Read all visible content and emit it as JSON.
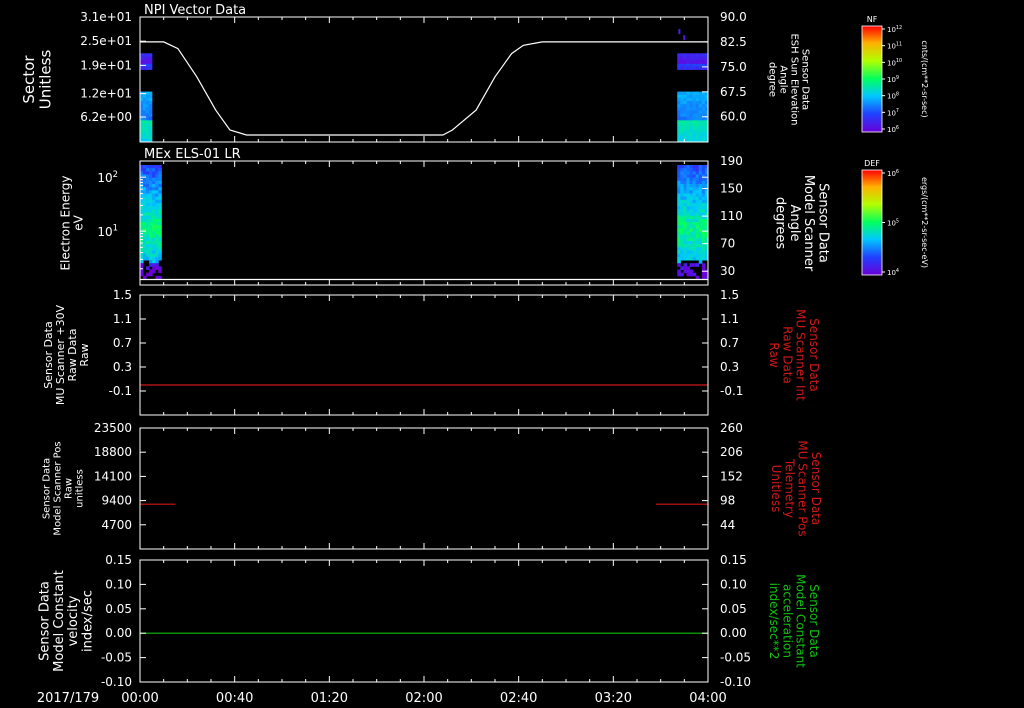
{
  "colors": {
    "background": "#000000",
    "foreground": "#ffffff",
    "red": "#d01818",
    "green": "#10c010"
  },
  "time_axis": {
    "date_label": "2017/179",
    "ticks": [
      "00:00",
      "00:40",
      "01:20",
      "02:00",
      "02:40",
      "03:20",
      "04:00"
    ],
    "range_minutes": [
      0,
      240
    ]
  },
  "chart_data": [
    {
      "type": "heatmap",
      "title": "NPI Vector Data",
      "ylabel": [
        "Sector",
        "Unitless"
      ],
      "y_ticks": [
        "3.1e+01",
        "2.5e+01",
        "1.9e+01",
        "1.2e+01",
        "6.2e+00"
      ],
      "y_tick_values": [
        31,
        25,
        19,
        12,
        6.2
      ],
      "ylim": [
        0,
        31
      ],
      "right_axis": {
        "label": [
          "Sensor Data",
          "ESH Sun Elevation",
          "Angle",
          "degree"
        ],
        "ticks": [
          "90.0",
          "82.5",
          "75.0",
          "67.5",
          "60.0"
        ],
        "tick_values": [
          90,
          82.5,
          75,
          67.5,
          60
        ],
        "ylim": [
          52.4,
          90
        ]
      },
      "color_bar": {
        "label": "NF",
        "units": "cnts/(cm**2-sr-sec)",
        "ticks": [
          "10^12",
          "10^11",
          "10^10",
          "10^9",
          "10^8",
          "10^7",
          "10^6"
        ]
      },
      "coverage_minutes": [
        [
          0,
          5
        ],
        [
          227,
          240
        ]
      ],
      "line_series": {
        "name": "ESH Sun Elevation",
        "color": "#ffffff",
        "x": [
          0,
          10,
          16,
          24,
          32,
          38,
          45,
          60,
          90,
          120,
          128,
          132,
          142,
          150,
          157,
          162,
          170,
          190,
          240
        ],
        "y": [
          82.5,
          82.5,
          80.5,
          72,
          62,
          56,
          54.5,
          54.5,
          54.5,
          54.5,
          54.5,
          56,
          62,
          72,
          79,
          81.5,
          82.5,
          82.5,
          82.5
        ]
      }
    },
    {
      "type": "heatmap",
      "title": "MEx ELS-01 LR",
      "ylabel": [
        "Electron Energy",
        "eV"
      ],
      "y_ticks": [
        "10^2",
        "10^1"
      ],
      "log_scale": true,
      "ylim": [
        1,
        200
      ],
      "right_axis": {
        "label": [
          "Sensor Data",
          "Model Scanner",
          "Angle",
          "degrees"
        ],
        "ticks": [
          "190",
          "150",
          "110",
          "70",
          "30"
        ],
        "tick_values": [
          190,
          150,
          110,
          70,
          30
        ],
        "ylim": [
          10,
          190
        ]
      },
      "color_bar": {
        "label": "DEF",
        "units": "ergs/(cm**2-sr-sec-eV)",
        "ticks": [
          "10^6",
          "10^5",
          "10^4"
        ]
      },
      "coverage_minutes": [
        [
          0,
          9
        ],
        [
          227,
          240
        ]
      ],
      "line_series": {
        "name": "Model Scanner Angle",
        "color": "#ffffff",
        "x": [
          0,
          240
        ],
        "y": [
          18,
          18
        ]
      }
    },
    {
      "type": "line",
      "ylabel": [
        "Sensor Data",
        "MU Scanner +30V",
        "Raw Data",
        "Raw"
      ],
      "y_ticks": [
        "1.5",
        "1.1",
        "0.7",
        "0.3",
        "-0.1"
      ],
      "ylim": [
        -0.5,
        1.5
      ],
      "right_axis": {
        "label": [
          "Sensor Data",
          "MU Scanner Int",
          "Raw Data",
          "Raw"
        ],
        "label_color": "#d01818",
        "ticks": [
          "1.5",
          "1.1",
          "0.7",
          "0.3",
          "-0.1"
        ],
        "ylim": [
          -0.5,
          1.5
        ]
      },
      "series": [
        {
          "color": "#d01818",
          "x": [
            0,
            240
          ],
          "y": [
            0.0,
            0.0
          ]
        }
      ]
    },
    {
      "type": "line",
      "ylabel": [
        "Sensor Data",
        "Model Scanner Pos",
        "Raw",
        "unitless"
      ],
      "y_ticks": [
        "23500",
        "18800",
        "14100",
        "9400",
        "4700"
      ],
      "ylim": [
        0,
        23500
      ],
      "right_axis": {
        "label": [
          "Sensor Data",
          "MU Scanner Pos",
          "Telemetry",
          "Unitless"
        ],
        "label_color": "#d01818",
        "ticks": [
          "260",
          "206",
          "152",
          "98",
          "44"
        ],
        "tick_values": [
          260,
          206,
          152,
          98,
          44
        ],
        "ylim": [
          -10,
          260
        ]
      },
      "series": [
        {
          "color": "#d01818",
          "x": [
            0,
            15
          ],
          "y": [
            90,
            90
          ]
        },
        {
          "color": "#d01818",
          "x": [
            218,
            240
          ],
          "y": [
            90,
            90
          ]
        }
      ]
    },
    {
      "type": "line",
      "ylabel": [
        "Sensor Data",
        "Model Constant",
        "velocity",
        "index/sec"
      ],
      "y_ticks": [
        "0.15",
        "0.10",
        "0.05",
        "0.00",
        "-0.05",
        "-0.10"
      ],
      "ylim": [
        -0.1,
        0.15
      ],
      "right_axis": {
        "label": [
          "Sensor Data",
          "Model Constant",
          "acceleration",
          "index/sec**2"
        ],
        "label_color": "#10c010",
        "ticks": [
          "0.15",
          "0.10",
          "0.05",
          "0.00",
          "-0.05",
          "-0.10"
        ],
        "ylim": [
          -0.1,
          0.15
        ]
      },
      "series": [
        {
          "color": "#10c010",
          "x": [
            0,
            240
          ],
          "y": [
            0,
            0
          ]
        }
      ]
    }
  ]
}
